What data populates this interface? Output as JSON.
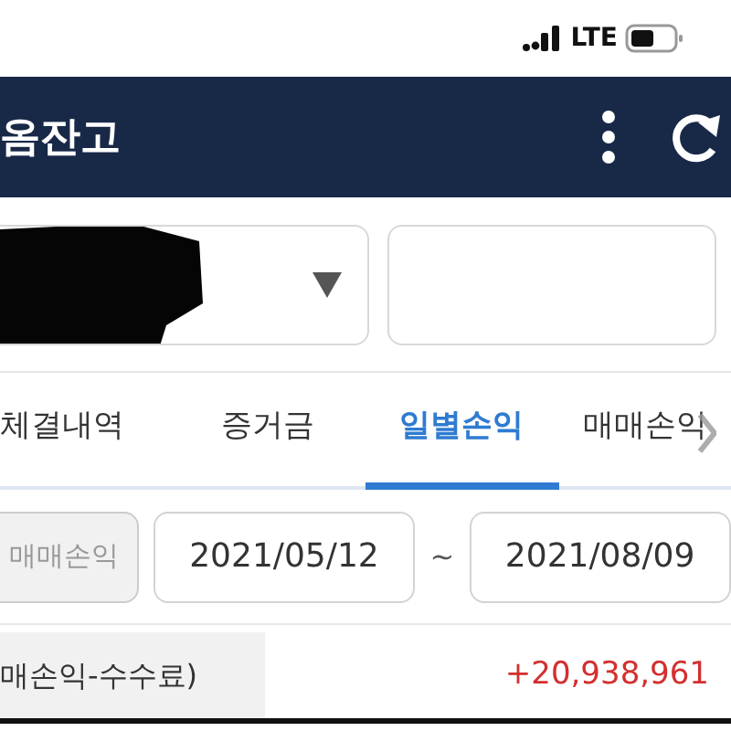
{
  "status_bar": {
    "network": "LTE"
  },
  "header": {
    "title": "옴잔고"
  },
  "filters": {
    "account": {
      "redacted": true
    }
  },
  "tabs": [
    {
      "label": "체결내역",
      "selected": false
    },
    {
      "label": "증거금",
      "selected": false
    },
    {
      "label": "일별손익",
      "selected": true
    },
    {
      "label": "매매손익",
      "selected": false
    }
  ],
  "period": {
    "mode_button": {
      "label": "매매손익",
      "disabled": true
    },
    "start": "2021/05/12",
    "separator": "~",
    "end": "2021/08/09"
  },
  "summary": {
    "label": "매손익-수수료)",
    "value": "+20,938,961",
    "positive": true
  }
}
